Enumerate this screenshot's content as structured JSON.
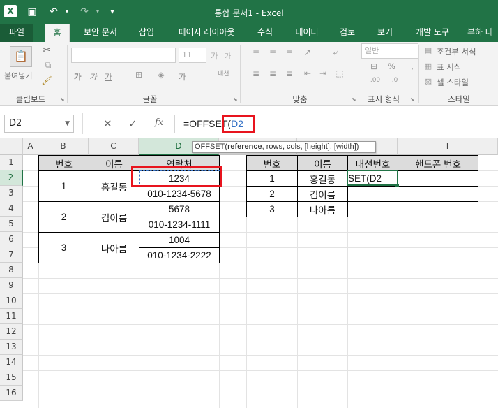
{
  "window": {
    "title": "통합 문서1 - Excel",
    "logo": "X"
  },
  "quick_access": {
    "save_icon": "save-icon",
    "undo_icon": "undo-icon",
    "redo_icon": "redo-icon"
  },
  "tabs": [
    {
      "label": "파일"
    },
    {
      "label": "홈"
    },
    {
      "label": "보안 문서"
    },
    {
      "label": "삽입"
    },
    {
      "label": "페이지 레이아웃"
    },
    {
      "label": "수식"
    },
    {
      "label": "데이터"
    },
    {
      "label": "검토"
    },
    {
      "label": "보기"
    },
    {
      "label": "개발 도구"
    },
    {
      "label": "부하 테"
    }
  ],
  "ribbon": {
    "clipboard": {
      "label": "클립보드",
      "paste_label": "붙여넣기"
    },
    "font": {
      "label": "글꼴",
      "font_size": "11",
      "bold": "가",
      "italic": "가",
      "underline": "가",
      "fontcolor": "가",
      "grow": "가",
      "shrink": "가",
      "phonetic": "내천"
    },
    "alignment": {
      "label": "맞춤"
    },
    "number": {
      "label": "표시 형식",
      "format": "일반",
      "percent": "%"
    },
    "styles": {
      "label": "스타일",
      "cond_format": "조건부 서식",
      "table_format": "표 서식",
      "cell_styles": "셀 스타일"
    }
  },
  "formula_bar": {
    "name_box": "D2",
    "cancel": "✕",
    "enter": "✓",
    "fx": "fx",
    "formula_prefix": "=OFFSET(",
    "formula_ref": "D2"
  },
  "tooltip": {
    "fn": "OFFSET(",
    "arg1": "reference",
    "rest": ", rows, cols, [height], [width])"
  },
  "grid": {
    "columns": [
      "A",
      "B",
      "C",
      "D",
      "",
      "",
      "",
      "",
      "I"
    ],
    "rows": [
      "1",
      "2",
      "3",
      "4",
      "5",
      "6",
      "7",
      "8",
      "9",
      "10",
      "11",
      "12",
      "13",
      "14",
      "15",
      "16"
    ],
    "left_table": {
      "headers": [
        "번호",
        "이름",
        "연락처"
      ],
      "groups": [
        {
          "num": "1",
          "name": "홍길동",
          "contact1": "1234",
          "contact2": "010-1234-5678"
        },
        {
          "num": "2",
          "name": "김이름",
          "contact1": "5678",
          "contact2": "010-1234-1111"
        },
        {
          "num": "3",
          "name": "나아름",
          "contact1": "1004",
          "contact2": "010-1234-2222"
        }
      ]
    },
    "right_table": {
      "headers": [
        "번호",
        "이름",
        "내선번호",
        "핸드폰 번호"
      ],
      "rows": [
        {
          "num": "1",
          "name": "홍길동",
          "ext": "SET(D2",
          "phone": ""
        },
        {
          "num": "2",
          "name": "김이름",
          "ext": "",
          "phone": ""
        },
        {
          "num": "3",
          "name": "나아름",
          "ext": "",
          "phone": ""
        }
      ]
    }
  },
  "colors": {
    "excel_green": "#217346",
    "highlight_red": "#e8141e",
    "ref_blue": "#3572c6"
  }
}
